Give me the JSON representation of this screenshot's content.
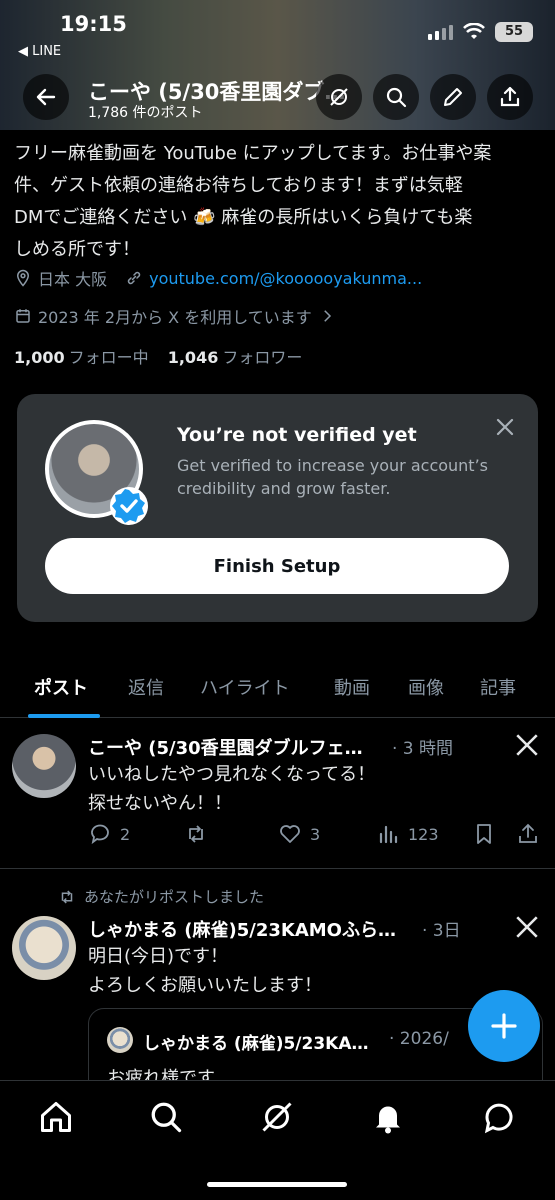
{
  "status_bar": {
    "time": "19:15",
    "back_app": "◀ LINE",
    "battery": "55"
  },
  "header": {
    "display_name": "こーや (5/30香里園ダブ…",
    "post_count": "1,786 件のポスト"
  },
  "profile": {
    "bio_lines": [
      "フリー麻雀動画を YouTube にアップしてます。お仕事や案",
      "件、ゲスト依頼の連絡お待ちしております！まずは気軽",
      "DMでご連絡ください 🍻 麻雀の長所はいくら負けても楽",
      "しめる所です！"
    ],
    "location": "日本 大阪",
    "link": "youtube.com/@koooooyakunma...",
    "joined": "2023 年 2月から X を利用しています",
    "following_count": "1,000",
    "following_label": "フォロー中",
    "followers_count": "1,046",
    "followers_label": "フォロワー"
  },
  "verify_card": {
    "title": "You’re not verified yet",
    "description": "Get verified to increase your account’s credibility and grow faster.",
    "button": "Finish Setup"
  },
  "tabs": [
    "ポスト",
    "返信",
    "ハイライト",
    "動画",
    "画像",
    "記事"
  ],
  "posts": [
    {
      "name": "こーや (5/30香里園ダブルフェ…",
      "time": "· 3 時間",
      "text_lines": [
        "いいねしたやつ見れなくなってる！",
        "探せないやん！！"
      ],
      "replies": "2",
      "likes": "3",
      "views": "123"
    },
    {
      "repost_label": "あなたがリポストしました",
      "name": "しゃかまる (麻雀)5/23KAMOふら…",
      "time": "· 3日",
      "text_lines": [
        "明日(今日)です！",
        "よろしくお願いいたします！"
      ],
      "quote": {
        "name": "しゃかまる (麻雀)5/23KA…",
        "time": "· 2026/",
        "text": "お疲れ様です"
      }
    }
  ],
  "icons": {
    "accent": "#1d9bf0",
    "verified": "#1d9bf0"
  }
}
